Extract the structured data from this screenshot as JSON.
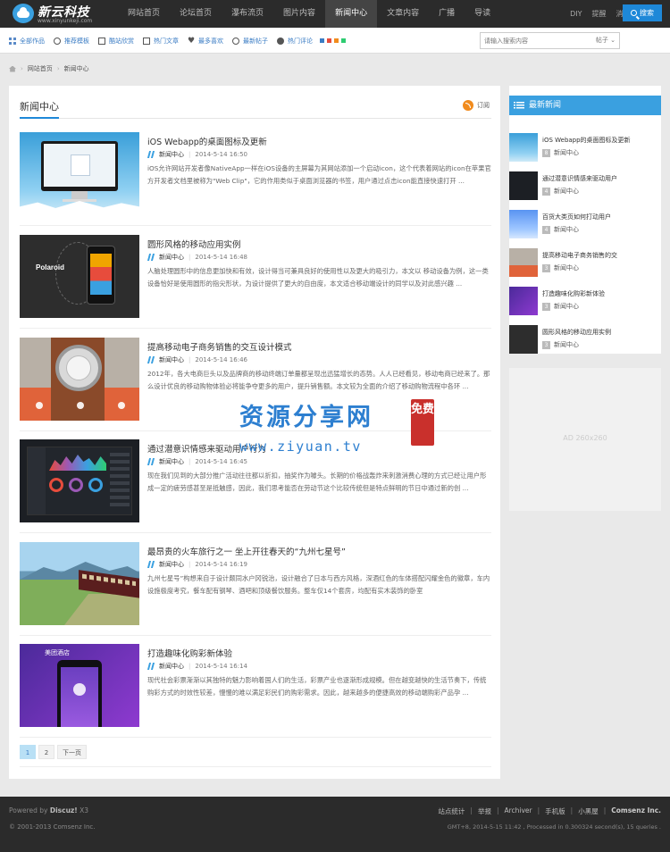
{
  "brand": {
    "name": "新云科技",
    "sub": "www.xinyunkeji.com"
  },
  "nav": [
    {
      "label": "网站首页"
    },
    {
      "label": "论坛首页"
    },
    {
      "label": "瀑布流页"
    },
    {
      "label": "图片内容"
    },
    {
      "label": "新闻中心",
      "active": true
    },
    {
      "label": "文章内容"
    },
    {
      "label": "广播"
    },
    {
      "label": "导读"
    }
  ],
  "top_right": {
    "diy": "DIY",
    "remind": "提醒",
    "messages": "消息"
  },
  "sublinks": [
    {
      "label": "全部作品",
      "icon": "grid-icon"
    },
    {
      "label": "推荐模板",
      "icon": "bulb-icon"
    },
    {
      "label": "酷站欣赏",
      "icon": "box-icon"
    },
    {
      "label": "热门文章",
      "icon": "box-icon"
    },
    {
      "label": "最多喜欢",
      "icon": "heart-icon"
    },
    {
      "label": "最新帖子",
      "icon": "clock-icon"
    },
    {
      "label": "热门评论",
      "icon": "bubble-icon"
    }
  ],
  "swatches": [
    "#3a7cc4",
    "#e74c3c",
    "#f18b1d",
    "#2ecc71"
  ],
  "search": {
    "placeholder": "请输入搜索内容",
    "scope": "帖子",
    "button": "搜索"
  },
  "breadcrumb": {
    "home": "网站首页",
    "current": "新闻中心"
  },
  "main": {
    "title": "新闻中心",
    "rss": "订阅",
    "articles": [
      {
        "title": "iOS Webapp的桌面图标及更新",
        "category": "新闻中心",
        "date": "2014-5-14 16:50",
        "summary": "iOS允许网站开发者像NativeApp一样在iOS设备的主屏幕为其网站添加一个启动icon，这个代表着网站的icon在苹果官方开发者文档里被称为\"Web Clip\"，它的作用类似于桌面浏览器的书签，用户通过点击icon能直接快速打开 ..."
      },
      {
        "title": "圆形风格的移动应用实例",
        "category": "新闻中心",
        "date": "2014-5-14 16:48",
        "summary": "人脑处理圆形中的信息更加快和有效，设计得当可兼具良好的使用性以及更大的吸引力，本文以 移动设备为例，这一类设备恰好是使用圆形的指尖形状，为设计提供了更大的自由度，本文适合移动端设计的同学以及对此感兴趣 ..."
      },
      {
        "title": "提高移动电子商务销售的交互设计模式",
        "category": "新闻中心",
        "date": "2014-5-14 16:46",
        "summary": "2012年，各大电商巨头以及品牌商的移动终端订单量都呈现出迅猛增长的态势。人人已经看见，移动电商已经来了。那么设计优良的移动购物体验必将能争夺更多的用户，提升销售额。本文较为全面的介绍了移动购物流程中各环 ..."
      },
      {
        "title": "通过潜意识情感来驱动用户行为",
        "category": "新闻中心",
        "date": "2014-5-14 16:45",
        "summary": "现在我们见到的大部分推广活动往往都以折扣，抽奖作为噱头。长期的价格战轰炸来刺激消费心理的方式已经让用户形成一定的疲劳感甚至是抵触感，因此，我们思考能否在劳动节这个比较传统但是特点鲜明的节日中通过新的创 ..."
      },
      {
        "title": "最昂贵的火车旅行之一 坐上开往春天的“九州七星号”",
        "category": "新闻中心",
        "date": "2014-5-14 16:19",
        "summary": "九州七星号”构想来自于设计颇同水户冈锐治，设计融合了日本与西方风格，深酒红色的车体搭配闪耀金色的徽章，车内设施极度考究，餐车配有钢琴、酒吧和顶级餐饮服务。整车仅14个套房，均配有实木装饰的卧室"
      },
      {
        "title": "打造趣味化购彩新体验",
        "category": "新闻中心",
        "date": "2014-5-14 16:14",
        "summary": "现代社会彩票渐渐以其独特的魅力影响着国人们的生活，彩票产业也逐渐形成规模。但在越变越快的生活节奏下，传统购彩方式的时效性较差，慢慢的难以满足彩民们的购彩需求。因此，越来越多的便捷高效的移动端购彩产品孕 ..."
      }
    ],
    "thumb_labels": {
      "polaroid": "Polaroid",
      "hotel": "美团酒店"
    },
    "pagination": {
      "pages": [
        "1",
        "2"
      ],
      "active": "1",
      "next": "下一页"
    }
  },
  "sidebar": {
    "title": "最新新闻",
    "items": [
      {
        "title": "iOS Webapp的桌面图标及更新",
        "count": "8",
        "category": "新闻中心"
      },
      {
        "title": "通过潜意识情感来驱动用户",
        "count": "4",
        "category": "新闻中心"
      },
      {
        "title": "百货大类页如何打动用户",
        "count": "4",
        "category": "新闻中心"
      },
      {
        "title": "提高移动电子商务销售的交",
        "count": "3",
        "category": "新闻中心"
      },
      {
        "title": "打造趣味化购彩新体验",
        "count": "3",
        "category": "新闻中心"
      },
      {
        "title": "圆形风格的移动应用实例",
        "count": "3",
        "category": "新闻中心"
      }
    ],
    "ad": "AD 260x260"
  },
  "watermark": {
    "cn": "资源分享网",
    "free": "免费",
    "url": "www.ziyuan.tv"
  },
  "footer": {
    "powered_prefix": "Powered by ",
    "powered_brand": "Discuz!",
    "powered_version": " X3",
    "copyright": "© 2001-2013 Comsenz Inc.",
    "links": [
      "站点统计",
      "举报",
      "Archiver",
      "手机版",
      "小黑屋"
    ],
    "company": "Comsenz Inc.",
    "stats": "GMT+8, 2014-5-15 11:42 , Processed in 0.300324 second(s), 15 queries ."
  }
}
